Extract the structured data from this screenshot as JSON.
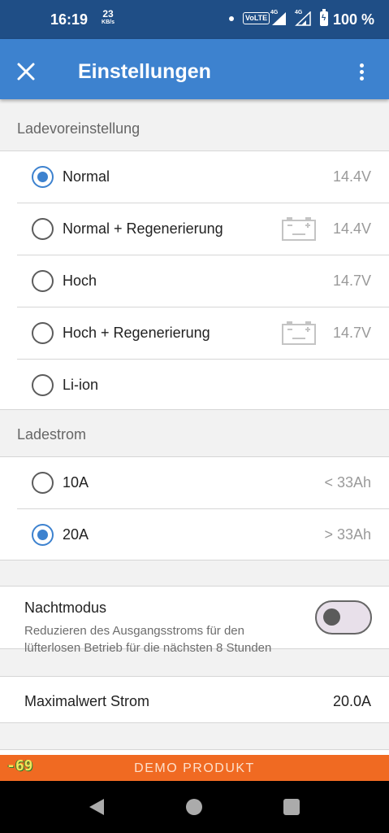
{
  "status_bar": {
    "time": "16:19",
    "net_speed_value": "23",
    "net_speed_unit": "KB/s",
    "volte": "VoLTE",
    "sim1_network": "4G",
    "sim2_network": "4G",
    "battery_percent": "100 %",
    "icons": [
      "notification-dot-icon",
      "signal-icon",
      "battery-charging-icon"
    ]
  },
  "app_bar": {
    "title": "Einstellungen",
    "close_icon": "close-icon",
    "menu_icon": "more-vert-icon",
    "color": "#3d82cf"
  },
  "preset_section": {
    "header": "Ladevoreinstellung",
    "options": [
      {
        "label": "Normal",
        "value": "14.4V",
        "selected": true,
        "battery_icon": false
      },
      {
        "label": "Normal + Regenerierung",
        "value": "14.4V",
        "selected": false,
        "battery_icon": true
      },
      {
        "label": "Hoch",
        "value": "14.7V",
        "selected": false,
        "battery_icon": false
      },
      {
        "label": "Hoch + Regenerierung",
        "value": "14.7V",
        "selected": false,
        "battery_icon": true
      },
      {
        "label": "Li-ion",
        "value": "",
        "selected": false,
        "battery_icon": false
      }
    ]
  },
  "current_section": {
    "header": "Ladestrom",
    "options": [
      {
        "label": "10A",
        "value": "< 33Ah",
        "selected": false
      },
      {
        "label": "20A",
        "value": "> 33Ah",
        "selected": true
      }
    ]
  },
  "night_mode": {
    "title": "Nachtmodus",
    "description": "Reduzieren des Ausgangsstroms für den lüfterlosen Betrieb für die nächsten 8 Stunden",
    "enabled": false
  },
  "max_current": {
    "label": "Maximalwert Strom",
    "value": "20.0A"
  },
  "demo_banner": {
    "text": "DEMO PRODUKT",
    "rssi": "-69",
    "color": "#f06a22"
  },
  "nav_bar": {
    "icons": [
      "back-icon",
      "home-icon",
      "recents-icon"
    ]
  }
}
